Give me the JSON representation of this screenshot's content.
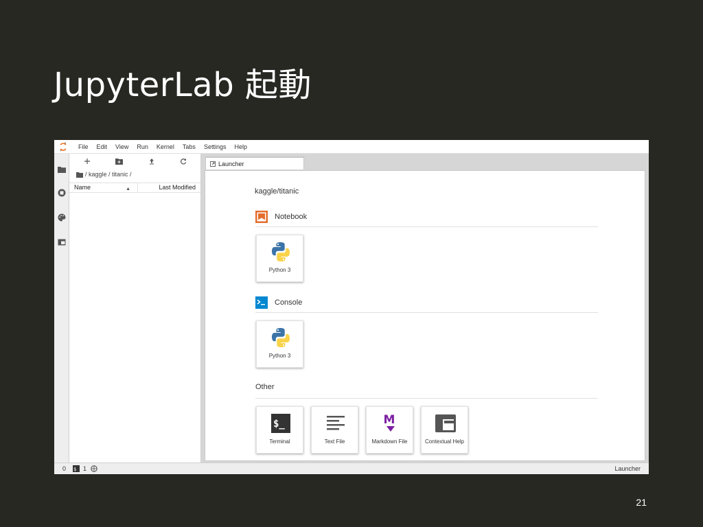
{
  "slide": {
    "title": "JupyterLab 起動",
    "page_number": "21"
  },
  "menubar": {
    "items": [
      "File",
      "Edit",
      "View",
      "Run",
      "Kernel",
      "Tabs",
      "Settings",
      "Help"
    ]
  },
  "activity_bar": {
    "icons": [
      "folder-icon",
      "running-icon",
      "palette-icon",
      "tabs-icon"
    ]
  },
  "file_browser": {
    "toolbar": [
      "new-launcher-icon",
      "new-folder-icon",
      "upload-icon",
      "refresh-icon"
    ],
    "breadcrumb": "/ kaggle / titanic /",
    "columns": {
      "name": "Name",
      "modified": "Last Modified"
    }
  },
  "main": {
    "tab_label": "Launcher",
    "cwd": "kaggle/titanic",
    "sections": {
      "notebook": {
        "label": "Notebook",
        "cards": [
          "Python 3"
        ]
      },
      "console": {
        "label": "Console",
        "cards": [
          "Python 3"
        ]
      },
      "other": {
        "label": "Other",
        "cards": [
          "Terminal",
          "Text File",
          "Markdown File",
          "Contextual Help"
        ]
      }
    }
  },
  "statusbar": {
    "kernels": "0",
    "terminals": "1",
    "mode": "Launcher"
  },
  "colors": {
    "slide_bg": "#272822",
    "notebook_accent": "#e46e2e",
    "console_accent": "#0288d1",
    "markdown_accent": "#7b1fa2",
    "python_blue": "#3c74a8",
    "python_yellow": "#f9d34a"
  }
}
